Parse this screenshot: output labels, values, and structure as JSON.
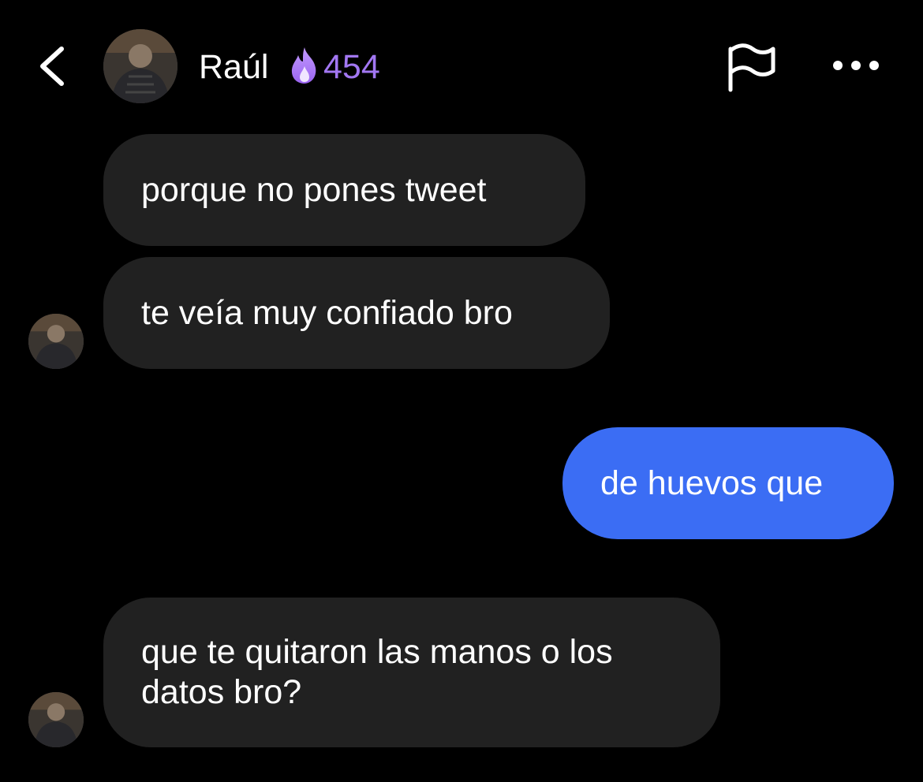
{
  "header": {
    "back_icon": "chevron-left-icon",
    "contact_name": "Raúl",
    "streak_icon": "flame-icon",
    "streak_count": "454",
    "streak_color": "#a277f2",
    "flag_icon": "flag-icon",
    "more_icon": "more-horizontal-icon"
  },
  "messages": [
    {
      "direction": "received",
      "text": "porque no pones tweet"
    },
    {
      "direction": "received",
      "text": "te veía muy confiado bro"
    },
    {
      "direction": "sent",
      "text": "de huevos que"
    },
    {
      "direction": "received",
      "text": "que te quitaron las manos o los datos bro?"
    }
  ],
  "colors": {
    "background": "#000000",
    "received_bubble": "#212121",
    "sent_bubble": "#3b6df4",
    "text": "#ffffff"
  }
}
